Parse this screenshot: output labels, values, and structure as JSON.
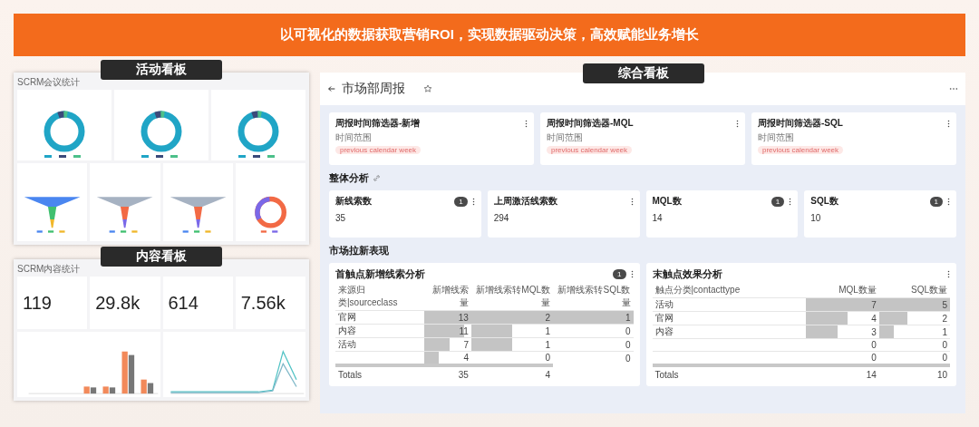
{
  "banner": {
    "title": "以可视化的数据获取营销ROI，实现数据驱动决策，高效赋能业务增长"
  },
  "activity_board": {
    "label": "活动看板",
    "title": "SCRM会议统计",
    "charts": [
      {
        "kind": "donut"
      },
      {
        "kind": "donut"
      },
      {
        "kind": "donut"
      },
      {
        "kind": "funnel"
      },
      {
        "kind": "funnel"
      },
      {
        "kind": "funnel"
      },
      {
        "kind": "ring"
      }
    ]
  },
  "content_board": {
    "label": "内容看板",
    "title": "SCRM内容统计",
    "stats": [
      {
        "value": "119"
      },
      {
        "value": "29.8k"
      },
      {
        "value": "614"
      },
      {
        "value": "7.56k"
      }
    ],
    "charts": [
      {
        "kind": "bar"
      },
      {
        "kind": "line"
      }
    ]
  },
  "summary_board": {
    "label": "综合看板",
    "title": "市场部周报",
    "filters": [
      {
        "title": "周报时间筛选器-新增",
        "field_label": "时间范围",
        "value": "previous calendar week"
      },
      {
        "title": "周报时间筛选器-MQL",
        "field_label": "时间范围",
        "value": "previous calendar week"
      },
      {
        "title": "周报时间筛选器-SQL",
        "field_label": "时间范围",
        "value": "previous calendar week"
      }
    ],
    "overall": {
      "heading": "整体分析",
      "metrics": [
        {
          "label": "新线索数",
          "value": "35",
          "filter_count": "1"
        },
        {
          "label": "上周激活线索数",
          "value": "294"
        },
        {
          "label": "MQL数",
          "value": "14",
          "filter_count": "1"
        },
        {
          "label": "SQL数",
          "value": "10",
          "filter_count": "1"
        }
      ]
    },
    "acquisition": {
      "heading": "市场拉新表现",
      "tables": [
        {
          "title": "首触点新增线索分析",
          "filter_count": "1",
          "columns": [
            "来源归类|sourceclass",
            "新增线索量",
            "新增线索转MQL数量",
            "新增线索转SQL数量"
          ],
          "rows": [
            {
              "label": "官网",
              "values": [
                "13",
                "2",
                "1"
              ]
            },
            {
              "label": "内容",
              "values": [
                "11",
                "1",
                "0"
              ]
            },
            {
              "label": "活动",
              "values": [
                "7",
                "1",
                "0"
              ]
            },
            {
              "values": [
                "4",
                "0",
                "0"
              ]
            }
          ],
          "totals": {
            "label": "Totals",
            "values": [
              "35",
              "4"
            ]
          }
        },
        {
          "title": "末触点效果分析",
          "columns": [
            "触点分类|contacttype",
            "MQL数量",
            "SQL数量"
          ],
          "rows": [
            {
              "label": "活动",
              "values": [
                "7",
                "5"
              ]
            },
            {
              "label": "官网",
              "values": [
                "4",
                "2"
              ]
            },
            {
              "label": "内容",
              "values": [
                "3",
                "1"
              ]
            },
            {
              "values": [
                "0",
                "0"
              ]
            },
            {
              "values": [
                "0",
                "0"
              ]
            }
          ],
          "totals": {
            "label": "Totals",
            "values": [
              "14",
              "10"
            ]
          }
        }
      ]
    }
  }
}
